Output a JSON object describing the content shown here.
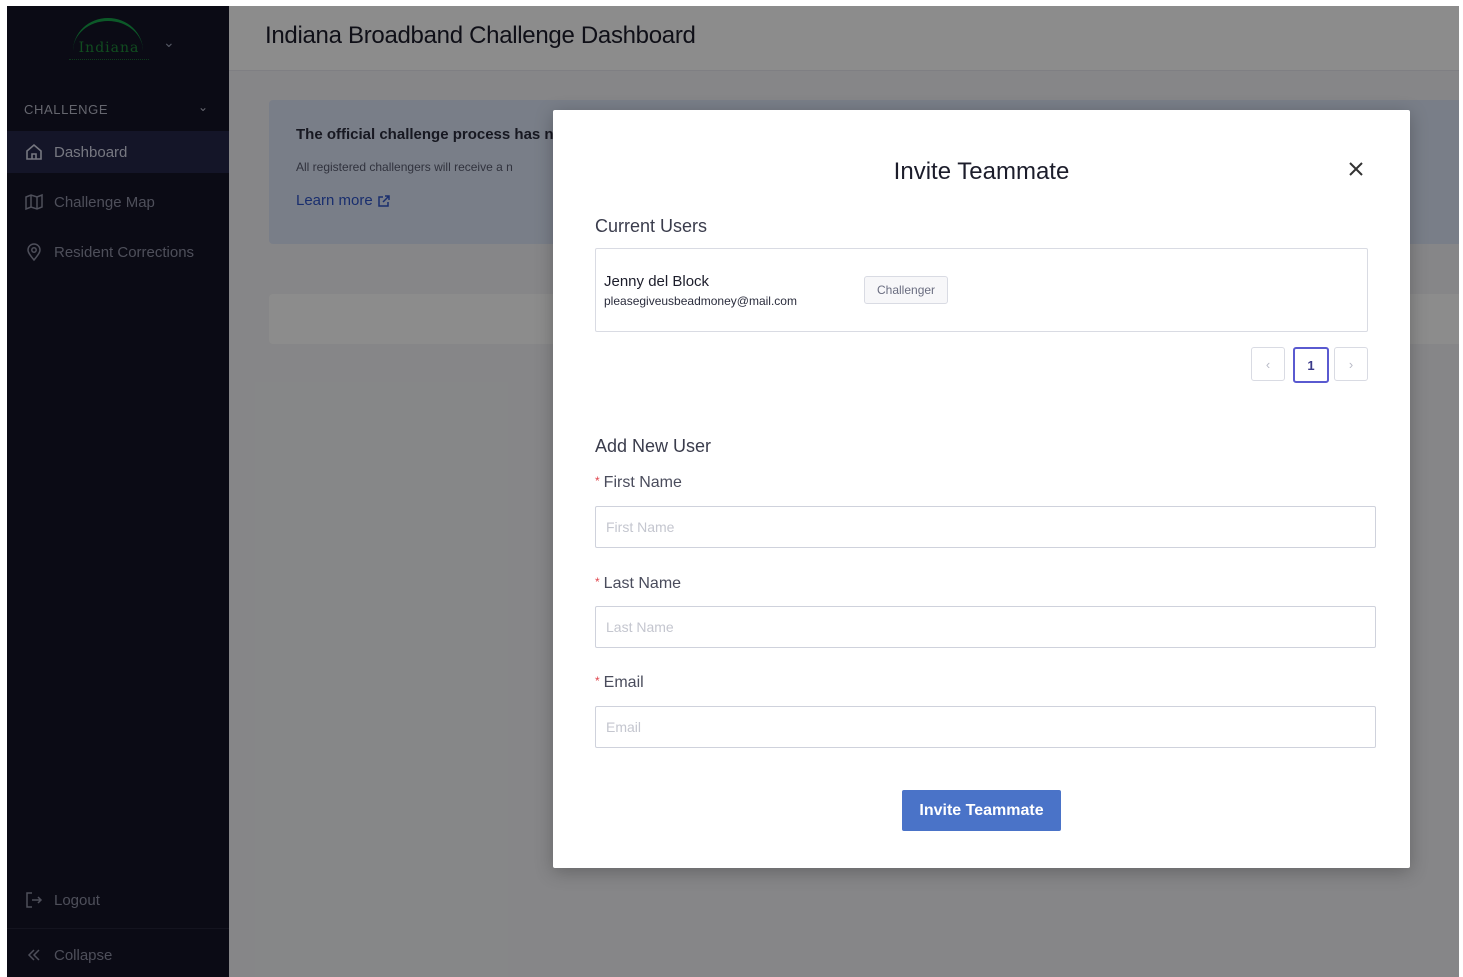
{
  "sidebar": {
    "logo_text": "Indiana",
    "section_label": "CHALLENGE",
    "items": [
      {
        "label": "Dashboard",
        "icon": "home-icon",
        "active": true
      },
      {
        "label": "Challenge Map",
        "icon": "map-icon",
        "active": false
      },
      {
        "label": "Resident Corrections",
        "icon": "location-pin-icon",
        "active": false
      }
    ],
    "logout_label": "Logout",
    "collapse_label": "Collapse"
  },
  "header": {
    "title": "Indiana Broadband Challenge Dashboard"
  },
  "notice": {
    "title": "The official challenge process has n",
    "text": "All registered challengers will receive a n",
    "link_label": "Learn more"
  },
  "modal": {
    "title": "Invite Teammate",
    "current_users_heading": "Current Users",
    "users": [
      {
        "name": "Jenny del Block",
        "email": "pleasegiveusbeadmoney@mail.com",
        "role": "Challenger"
      }
    ],
    "pagination": {
      "prev": "‹",
      "current": "1",
      "next": "›"
    },
    "add_user_heading": "Add New User",
    "fields": {
      "first_name": {
        "label": "First Name",
        "placeholder": "First Name",
        "value": ""
      },
      "last_name": {
        "label": "Last Name",
        "placeholder": "Last Name",
        "value": ""
      },
      "email": {
        "label": "Email",
        "placeholder": "Email",
        "value": ""
      }
    },
    "required_marker": "*",
    "submit_label": "Invite Teammate"
  },
  "colors": {
    "sidebar_bg": "#141427",
    "sidebar_active": "#25274a",
    "primary_button": "#4a73c8",
    "link": "#2f55c9",
    "required": "#e0464e"
  }
}
